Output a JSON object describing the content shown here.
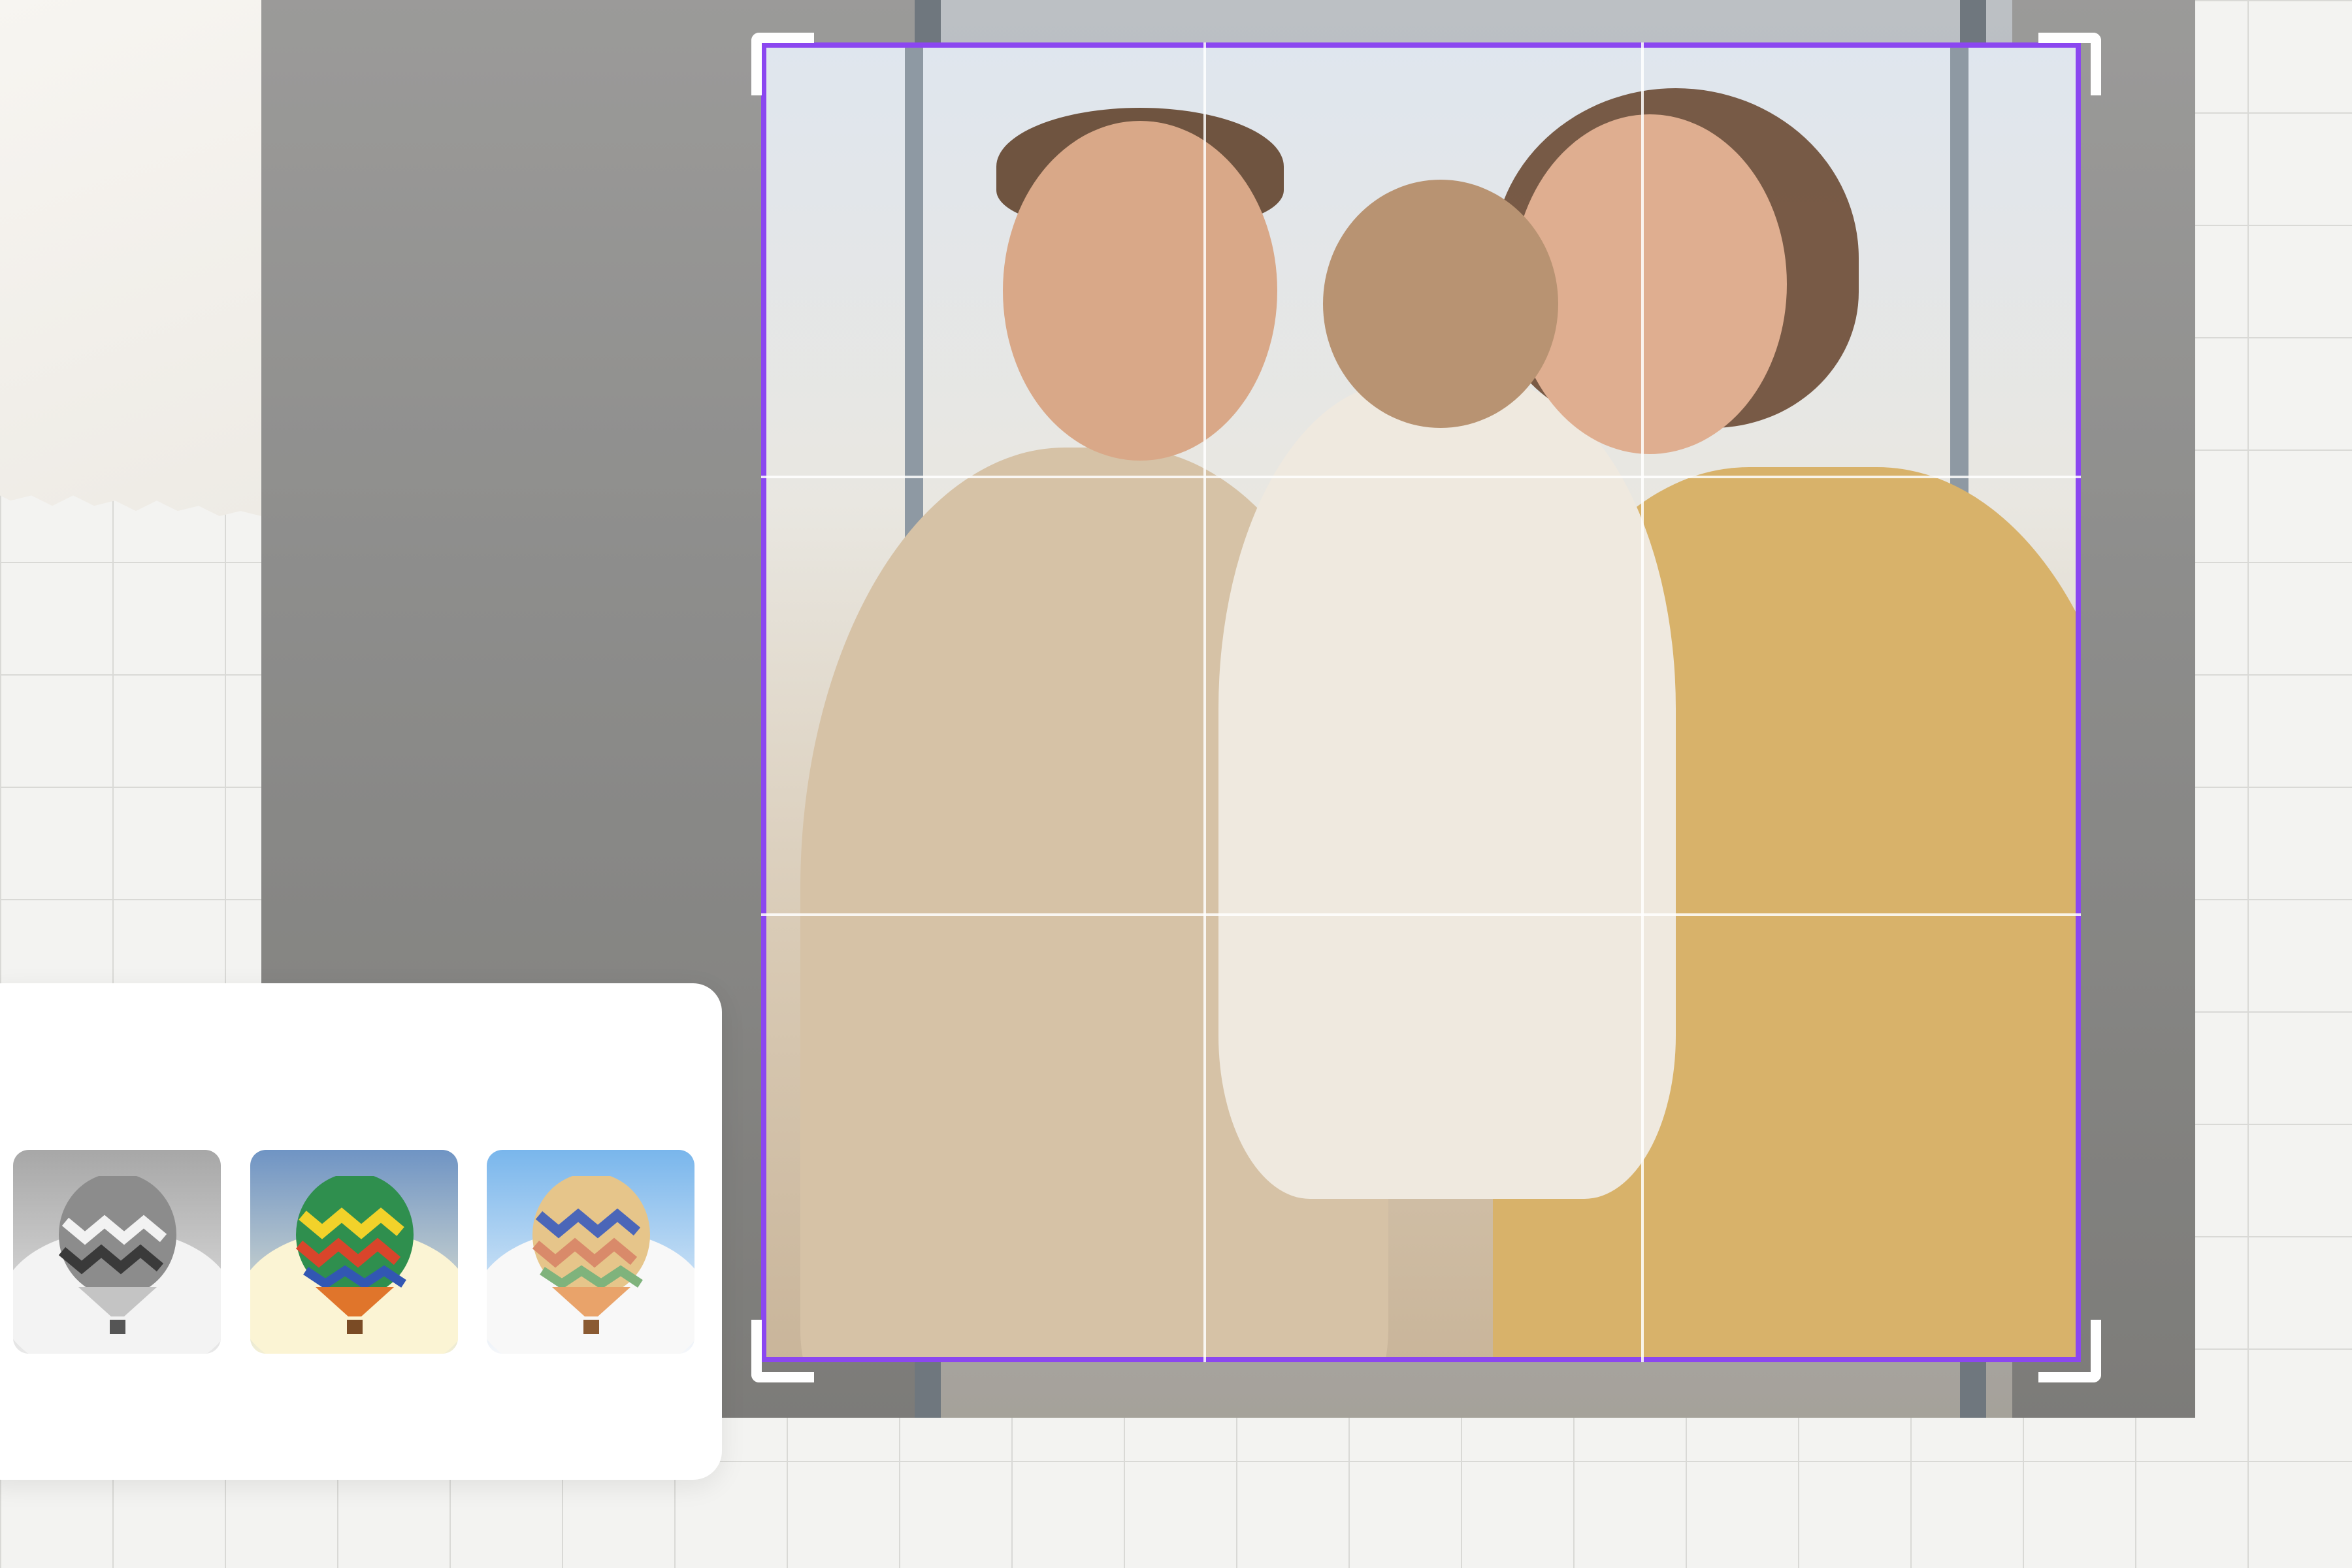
{
  "editor": {
    "tool": "crop",
    "crop_grid": "rule-of-thirds",
    "accent_color": "#8b47f0",
    "handle_color": "#ffffff"
  },
  "photo": {
    "subject": "family-hug-photo"
  },
  "filters": {
    "items": [
      {
        "name": "grayscale-filter",
        "icon": "hot-air-balloon-icon"
      },
      {
        "name": "vivid-filter",
        "icon": "hot-air-balloon-icon"
      },
      {
        "name": "pastel-filter",
        "icon": "hot-air-balloon-icon"
      }
    ]
  }
}
